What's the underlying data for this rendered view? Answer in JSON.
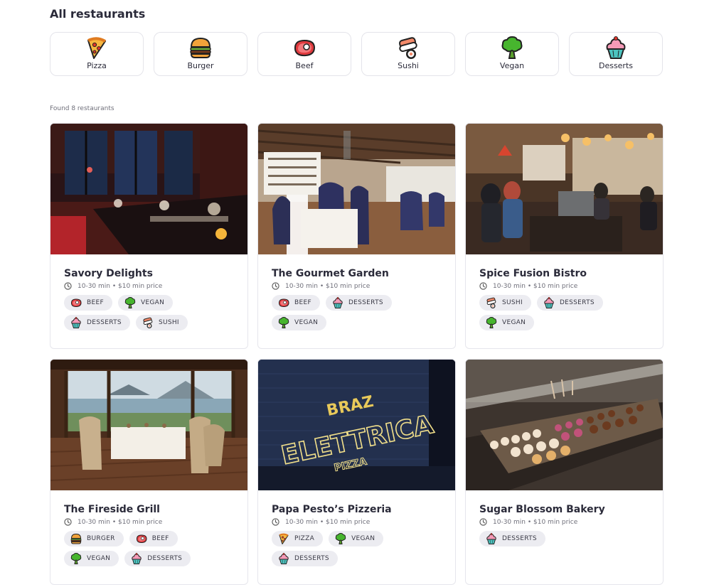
{
  "header": {
    "title": "All restaurants"
  },
  "categories": [
    {
      "label": "Pizza",
      "icon": "pizza-icon"
    },
    {
      "label": "Burger",
      "icon": "burger-icon"
    },
    {
      "label": "Beef",
      "icon": "beef-icon"
    },
    {
      "label": "Sushi",
      "icon": "sushi-icon"
    },
    {
      "label": "Vegan",
      "icon": "vegan-icon"
    },
    {
      "label": "Desserts",
      "icon": "desserts-icon"
    }
  ],
  "results": {
    "found_text": "Found 8 restaurants"
  },
  "restaurants": [
    {
      "name": "Savory Delights",
      "meta": "10-30 min • $10 min price",
      "tags": [
        "BEEF",
        "VEGAN",
        "DESSERTS",
        "SUSHI"
      ]
    },
    {
      "name": "The Gourmet Garden",
      "meta": "10-30 min • $10 min price",
      "tags": [
        "BEEF",
        "DESSERTS",
        "VEGAN"
      ]
    },
    {
      "name": "Spice Fusion Bistro",
      "meta": "10-30 min • $10 min price",
      "tags": [
        "SUSHI",
        "DESSERTS",
        "VEGAN"
      ]
    },
    {
      "name": "The Fireside Grill",
      "meta": "10-30 min • $10 min price",
      "tags": [
        "BURGER",
        "BEEF",
        "VEGAN",
        "DESSERTS"
      ]
    },
    {
      "name": "Papa Pesto’s Pizzeria",
      "meta": "10-30 min • $10 min price",
      "tags": [
        "PIZZA",
        "VEGAN",
        "DESSERTS"
      ]
    },
    {
      "name": "Sugar Blossom Bakery",
      "meta": "10-30 min • $10 min price",
      "tags": [
        "DESSERTS"
      ]
    }
  ],
  "photo_signs": {
    "sign_line1": "BRAZ",
    "sign_line2": "ELETTRICA",
    "sign_line3": "PIZZA"
  }
}
